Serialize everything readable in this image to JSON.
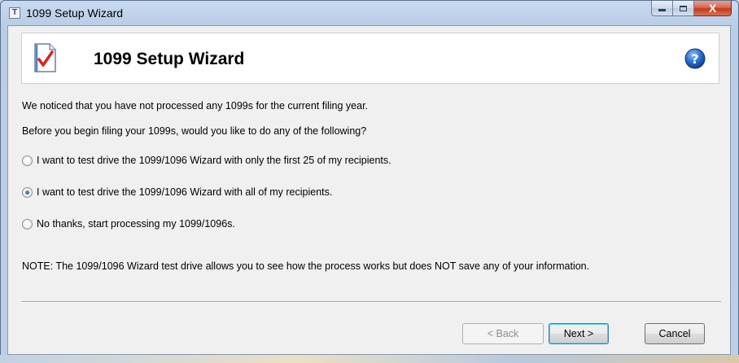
{
  "window": {
    "title": "1099 Setup Wizard",
    "app_icon_glyph": "T",
    "controls": {
      "minimize": "minimize-icon",
      "maximize": "maximize-icon",
      "close": "close-icon",
      "close_glyph": "X"
    }
  },
  "header": {
    "title": "1099 Setup Wizard",
    "icon": "document-checkmark-icon",
    "help_icon": "help-question-icon",
    "help_glyph": "?"
  },
  "body": {
    "notice": "We noticed that you have not processed any 1099s for the current filing year.",
    "question": "Before you begin filing your 1099s, would you like to do any of the following?",
    "options": [
      {
        "label": "I want to test drive the 1099/1096 Wizard with only the first 25 of my recipients.",
        "checked": false
      },
      {
        "label": "I want to test drive the 1099/1096 Wizard with all of my recipients.",
        "checked": true
      },
      {
        "label": "No thanks, start processing my 1099/1096s.",
        "checked": false
      }
    ],
    "note": "NOTE: The 1099/1096 Wizard test drive allows you to see how the process works but does NOT save any of your information."
  },
  "footer": {
    "back_label": "< Back",
    "next_label": "Next >",
    "cancel_label": "Cancel"
  },
  "colors": {
    "titlebar": "#c9daf0",
    "client_bg": "#f0f0f0",
    "check_red": "#d9261c",
    "help_blue": "#1f5fbf"
  }
}
